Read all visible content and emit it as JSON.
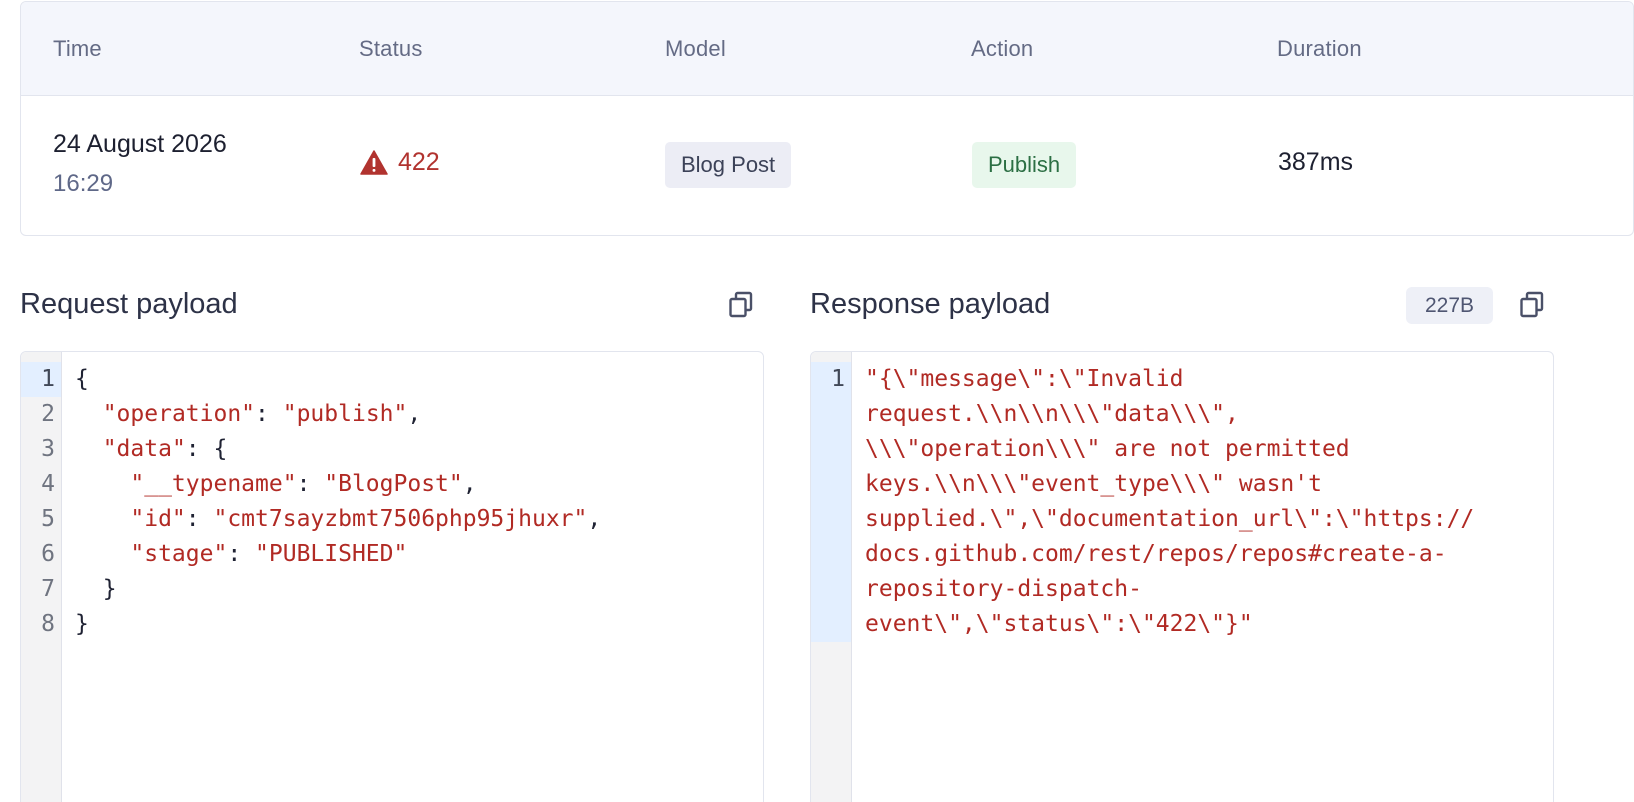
{
  "table": {
    "headers": [
      "Time",
      "Status",
      "Model",
      "Action",
      "Duration"
    ],
    "row": {
      "date": "24 August 2026",
      "time": "16:29",
      "status_code": "422",
      "status_icon": "warning-triangle-icon",
      "model": "Blog Post",
      "action": "Publish",
      "duration": "387ms"
    }
  },
  "request": {
    "title": "Request payload",
    "copy_icon": "copy-icon",
    "line_numbers": [
      "1",
      "2",
      "3",
      "4",
      "5",
      "6",
      "7",
      "8"
    ],
    "lines": [
      {
        "indent": "",
        "key": "",
        "sep": "",
        "value": "",
        "punct": "{"
      },
      {
        "indent": "  ",
        "key": "\"operation\"",
        "sep": ": ",
        "value": "\"publish\"",
        "punct": ","
      },
      {
        "indent": "  ",
        "key": "\"data\"",
        "sep": ": ",
        "value": "",
        "punct": "{"
      },
      {
        "indent": "    ",
        "key": "\"__typename\"",
        "sep": ": ",
        "value": "\"BlogPost\"",
        "punct": ","
      },
      {
        "indent": "    ",
        "key": "\"id\"",
        "sep": ": ",
        "value": "\"cmt7sayzbmt7506php95jhuxr\"",
        "punct": ","
      },
      {
        "indent": "    ",
        "key": "\"stage\"",
        "sep": ": ",
        "value": "\"PUBLISHED\"",
        "punct": ""
      },
      {
        "indent": "  ",
        "key": "",
        "sep": "",
        "value": "",
        "punct": "}"
      },
      {
        "indent": "",
        "key": "",
        "sep": "",
        "value": "",
        "punct": "}"
      }
    ]
  },
  "response": {
    "title": "Response payload",
    "size": "227B",
    "copy_icon": "copy-icon",
    "line_numbers": [
      "1"
    ],
    "wrapped_lines": [
      "\"{\\\"message\\\":\\\"Invalid",
      "request.\\\\n\\\\n\\\\\\\"data\\\\\\\",",
      "\\\\\\\"operation\\\\\\\" are not permitted",
      "keys.\\\\n\\\\\\\"event_type\\\\\\\" wasn't",
      "supplied.\\\",\\\"documentation_url\\\":\\\"https://",
      "docs.github.com/rest/repos/repos#create-a-",
      "repository-dispatch-",
      "event\\\",\\\"status\\\":\\\"422\\\"}\""
    ]
  },
  "colors": {
    "error": "#b1332f",
    "success_bg": "#e8f7ec",
    "success_text": "#2c6f44",
    "header_bg": "#f4f6fc"
  }
}
